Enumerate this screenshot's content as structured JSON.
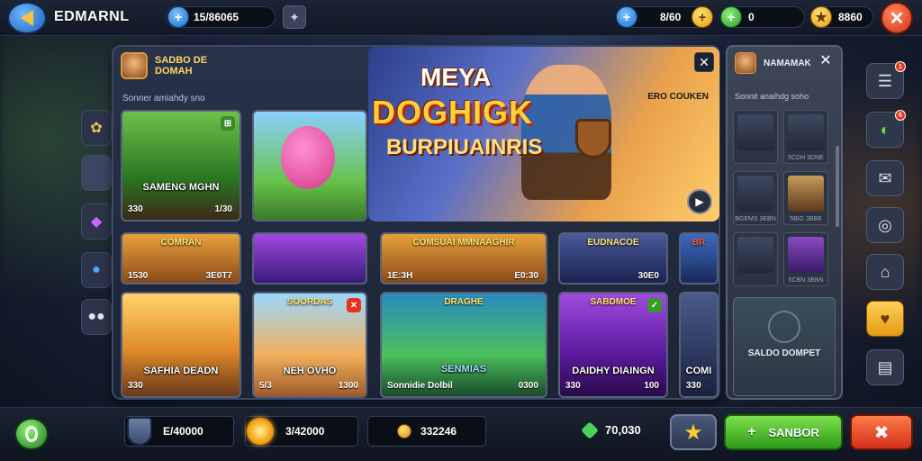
{
  "topbar": {
    "brand": "EDMARNL",
    "currency_a": "15/86065",
    "currency_b": "8/60",
    "currency_c": "0",
    "currency_d": "8860",
    "close_label": "✕",
    "add_label": "+"
  },
  "event": {
    "title": "SADBO DE DOMAH",
    "subtitle": "Sonner amiahdy sno"
  },
  "hero": {
    "title_a": "MEYA",
    "title_b": "DOGHIGK",
    "title_c": "BURPIUAINRIS",
    "tag": "ERO COUKEN",
    "close_label": "✕",
    "next_label": "▶"
  },
  "cards_row1": [
    {
      "label": "SAMENG MGHN",
      "stat_l": "330",
      "stat_r": "1/30",
      "badge": "⊞"
    },
    {
      "label": "",
      "stat_l": "",
      "stat_r": "",
      "badge": ""
    }
  ],
  "cards_row2": [
    {
      "top": "COMRAN",
      "stat_l": "1530",
      "stat_r": "3E0T7"
    },
    {
      "top": "",
      "stat_l": "",
      "stat_r": ""
    },
    {
      "top": "COMSUAI MMNAAGHIR",
      "stat_l": "1E:3H",
      "stat_r": "E0:30"
    },
    {
      "top": "EUDNACOE",
      "stat_l": "",
      "stat_r": "30E0"
    },
    {
      "top": "BR",
      "stat_l": "",
      "stat_r": ""
    }
  ],
  "cards_row3": [
    {
      "label": "SAFHIA DEADN",
      "stat_l": "330",
      "stat_r": ""
    },
    {
      "top": "SOORDAS",
      "label": "NEH OVHO",
      "stat_l": "5/3",
      "stat_r": "1300"
    },
    {
      "top": "DRAGHE",
      "label": "SENMIAS",
      "stat_l": "Sonnidie Dolbil",
      "stat_r": "0300"
    },
    {
      "top": "SABDMOE",
      "label": "DAIDHY DIAINGN",
      "stat_l": "330",
      "stat_r": "100"
    },
    {
      "label": "COMI",
      "stat_l": "330",
      "stat_r": ""
    }
  ],
  "right_panel": {
    "title": "NAMAMAK",
    "subtitle": "Sonnit anaihdg soho",
    "close_label": "✕",
    "minis": [
      "",
      "5CDH 3DNE",
      "BGEMS 3EBN",
      "5BIG 3BBE",
      "",
      "5CBN 3BBN"
    ],
    "big_label": "SALDO DOMPET"
  },
  "side_icons": [
    {
      "icon": "☰",
      "name": "menu-icon",
      "dot": "1"
    },
    {
      "icon": "◐",
      "name": "power-icon",
      "dot": "6"
    },
    {
      "icon": "✉",
      "name": "mail-icon",
      "dot": ""
    },
    {
      "icon": "◎",
      "name": "target-icon",
      "dot": ""
    },
    {
      "icon": "⌂",
      "name": "home-icon",
      "dot": ""
    },
    {
      "icon": "♥",
      "name": "heart-icon",
      "dot": ""
    },
    {
      "icon": "▤",
      "name": "list-icon",
      "dot": ""
    }
  ],
  "bottombar": {
    "res_a": "E/40000",
    "res_b": "3/42000",
    "res_c": "332246",
    "res_d": "70,030",
    "star_label": "★",
    "green_btn_label": "SANBOR",
    "green_btn_plus": "+",
    "red_btn_label": "✖"
  }
}
